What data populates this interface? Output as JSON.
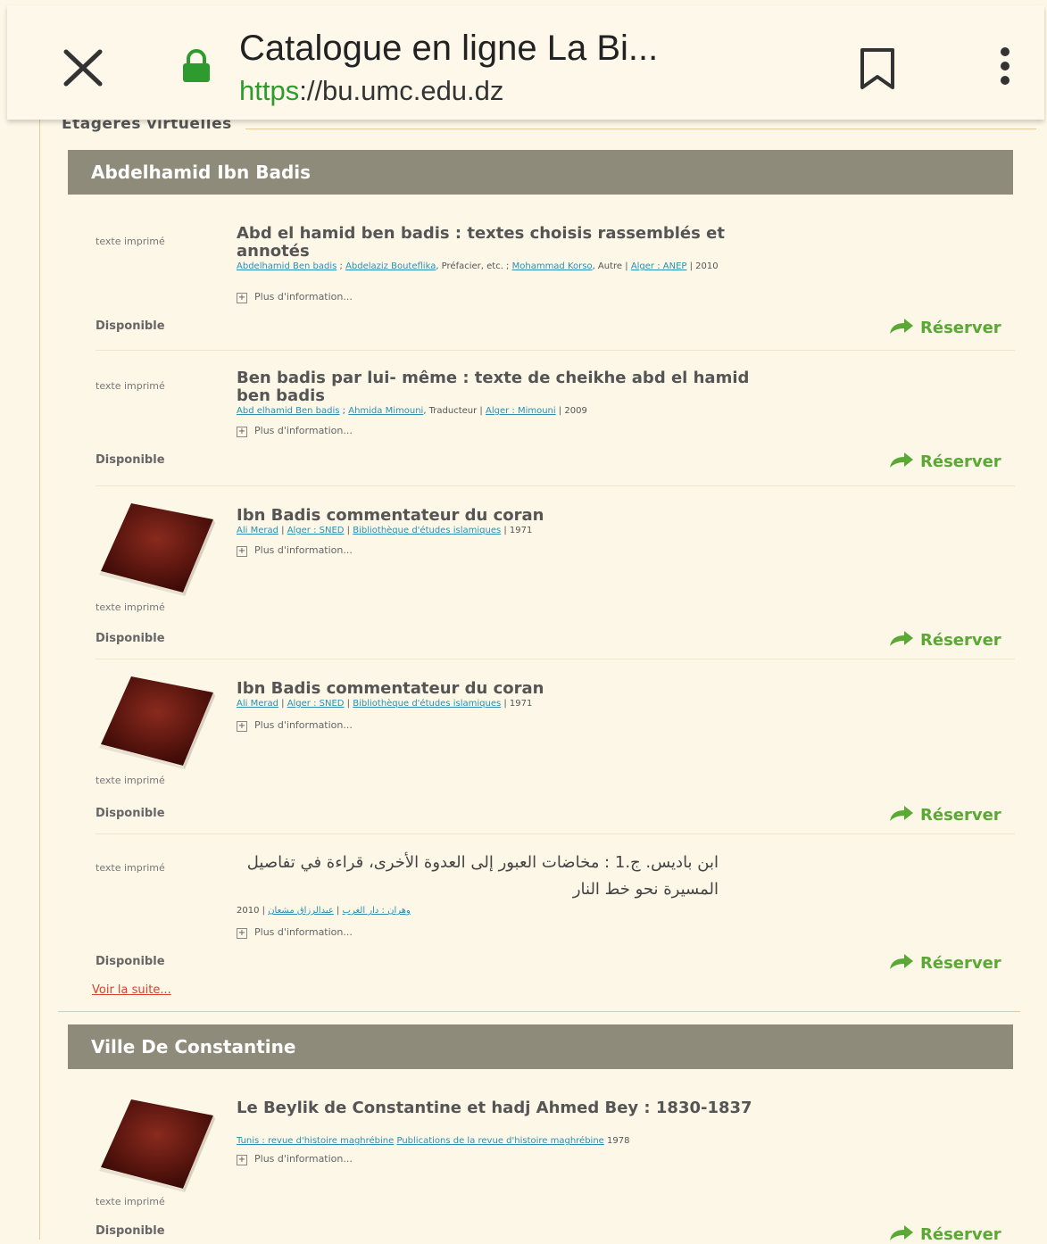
{
  "browser": {
    "title": "Catalogue en ligne La Bi...",
    "url_scheme": "https",
    "url_rest": "://bu.umc.edu.dz"
  },
  "fieldset": {
    "legend": "Etagères virtuelles"
  },
  "shelves": [
    {
      "name": "Abdelhamid Ibn Badis",
      "items": [
        {
          "doc_type": "texte imprimé",
          "title": "Abd el hamid ben badis : textes choisis rassemblés et annotés",
          "meta": [
            {
              "text": "Abdelhamid Ben badis",
              "link": true
            },
            {
              "text": " ; ",
              "link": false
            },
            {
              "text": "Abdelaziz Bouteflika",
              "link": true
            },
            {
              "text": ", Préfacier, etc. ; ",
              "link": false
            },
            {
              "text": "Mohammad Korso",
              "link": true
            },
            {
              "text": ", Autre | ",
              "link": false
            },
            {
              "text": "Alger : ANEP",
              "link": true
            },
            {
              "text": " | 2010",
              "link": false
            }
          ],
          "more": "Plus d'information...",
          "availability": "Disponible",
          "reserve": "Réserver"
        },
        {
          "doc_type": "texte imprimé",
          "title": "Ben badis par lui- même : texte de cheikhe abd el hamid ben badis",
          "meta": [
            {
              "text": "Abd elhamid Ben badis",
              "link": true
            },
            {
              "text": " ; ",
              "link": false
            },
            {
              "text": "Ahmida Mimouni",
              "link": true
            },
            {
              "text": ", Traducteur | ",
              "link": false
            },
            {
              "text": "Alger : Mimouni",
              "link": true
            },
            {
              "text": " | 2009",
              "link": false
            }
          ],
          "more": "Plus d'information...",
          "availability": "Disponible",
          "reserve": "Réserver"
        },
        {
          "doc_type": "texte imprimé",
          "title": "Ibn Badis commentateur du coran",
          "meta": [
            {
              "text": "Ali Merad",
              "link": true
            },
            {
              "text": " | ",
              "link": false
            },
            {
              "text": "Alger : SNED",
              "link": true
            },
            {
              "text": " | ",
              "link": false
            },
            {
              "text": "Bibliothèque d'études islamiques",
              "link": true
            },
            {
              "text": " | 1971",
              "link": false
            }
          ],
          "more": "Plus d'information...",
          "availability": "Disponible",
          "reserve": "Réserver"
        },
        {
          "doc_type": "texte imprimé",
          "title": "Ibn Badis commentateur du coran",
          "meta": [
            {
              "text": "Ali Merad",
              "link": true
            },
            {
              "text": " | ",
              "link": false
            },
            {
              "text": "Alger : SNED",
              "link": true
            },
            {
              "text": " | ",
              "link": false
            },
            {
              "text": "Bibliothèque d'études islamiques",
              "link": true
            },
            {
              "text": " | 1971",
              "link": false
            }
          ],
          "more": "Plus d'information...",
          "availability": "Disponible",
          "reserve": "Réserver"
        },
        {
          "doc_type": "texte imprimé",
          "title": "ابن باديس. ج.1 : مخاضات العبور إلى العدوة الأخرى، قراءة في تفاصيل المسيرة نحو خط النار",
          "meta": [
            {
              "text": "2010 | ",
              "link": false
            },
            {
              "text": "وهران : دار الغرب",
              "link": true
            },
            {
              "text": " | ",
              "link": false
            },
            {
              "text": "عبدالرزاق مشعان",
              "link": true
            }
          ],
          "more": "Plus d'information...",
          "availability": "Disponible",
          "reserve": "Réserver"
        }
      ],
      "see_more": "Voir la suite..."
    },
    {
      "name": "Ville De Constantine",
      "items": [
        {
          "doc_type": "texte imprimé",
          "title": "Le Beylik de Constantine et hadj Ahmed Bey : 1830-1837",
          "meta": [
            {
              "text": "Tunis : revue d'histoire maghrébine",
              "link": true
            },
            {
              "text": " ",
              "link": false
            },
            {
              "text": "Publications de la revue d'histoire maghrébine",
              "link": true
            },
            {
              "text": " 1978",
              "link": false
            }
          ],
          "more": "Plus d'information...",
          "availability": "Disponible",
          "reserve": "Réserver"
        }
      ]
    }
  ],
  "colors": {
    "page_bg": "#fdf7e8",
    "header_bg": "#8f8b7a",
    "reserve_green": "#5aa935",
    "link_blue": "#2a8fb0",
    "voir_red": "#d9412c",
    "lock_green": "#2e9b2e"
  },
  "icons": {
    "close": "close-icon",
    "lock": "lock-icon",
    "bookmark": "bookmark-icon",
    "menu": "more-vert-icon",
    "reserve": "share-arrow-icon",
    "book": "book-icon",
    "expand": "plus-box-icon"
  }
}
